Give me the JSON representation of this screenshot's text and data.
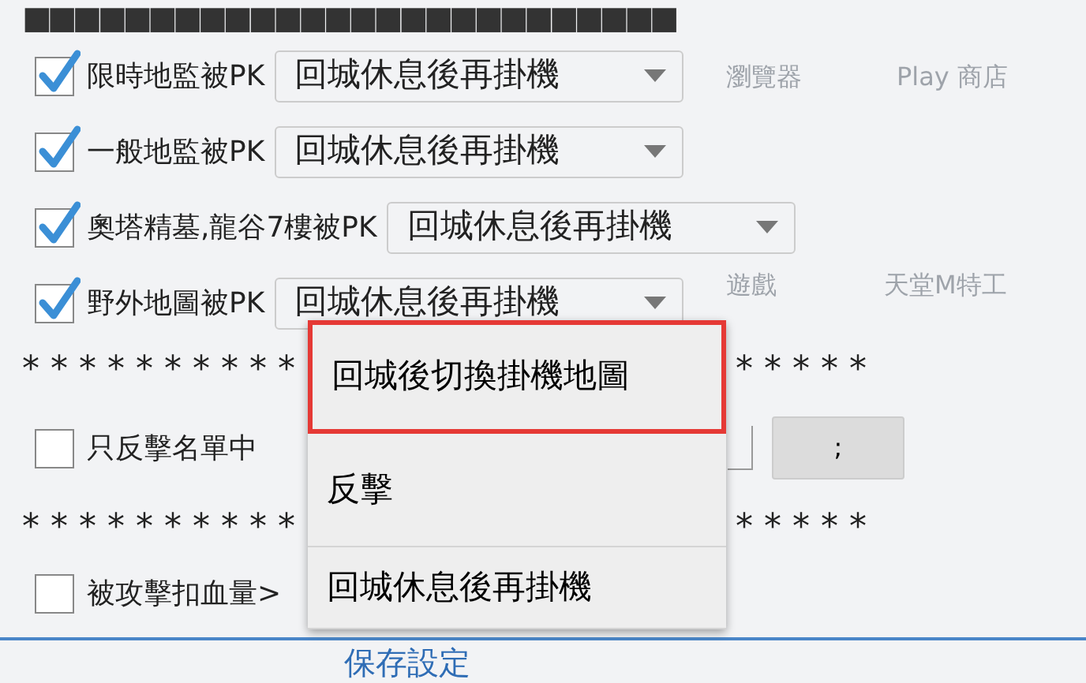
{
  "background_labels": [
    {
      "text": "瀏覽器"
    },
    {
      "text": "Play 商店"
    },
    {
      "text": "遊戲"
    },
    {
      "text": "天堂M特工"
    }
  ],
  "header": "■■■■■■■■■■■■■■■■■■■■■■■■■■",
  "rows": [
    {
      "kind": "check_select",
      "label": "限時地監被PK",
      "checked": true,
      "value": "回城休息後再掛機"
    },
    {
      "kind": "check_select",
      "label": "一般地監被PK",
      "checked": true,
      "value": "回城休息後再掛機"
    },
    {
      "kind": "check_select",
      "label": "奧塔精墓,龍谷7樓被PK",
      "checked": true,
      "value": "回城休息後再掛機"
    },
    {
      "kind": "check_select",
      "label": "野外地圖被PK",
      "checked": true,
      "value": "回城休息後再掛機"
    },
    {
      "kind": "stars",
      "left": "* * * * * * * * * *",
      "right": "* * * * *"
    },
    {
      "kind": "check_field_button",
      "label": "只反擊名單中",
      "checked": false,
      "button": ";"
    },
    {
      "kind": "stars",
      "left": "* * * * * * * * * *",
      "right": "* * * * *"
    },
    {
      "kind": "check_text",
      "label": "被攻擊扣血量>",
      "checked": false
    }
  ],
  "footer_button": "保存設定",
  "dropdown": {
    "options": [
      {
        "label": "回城後切換掛機地圖",
        "selected": true
      },
      {
        "label": "反擊",
        "selected": false
      },
      {
        "label": "回城休息後再掛機",
        "selected": false
      }
    ]
  }
}
